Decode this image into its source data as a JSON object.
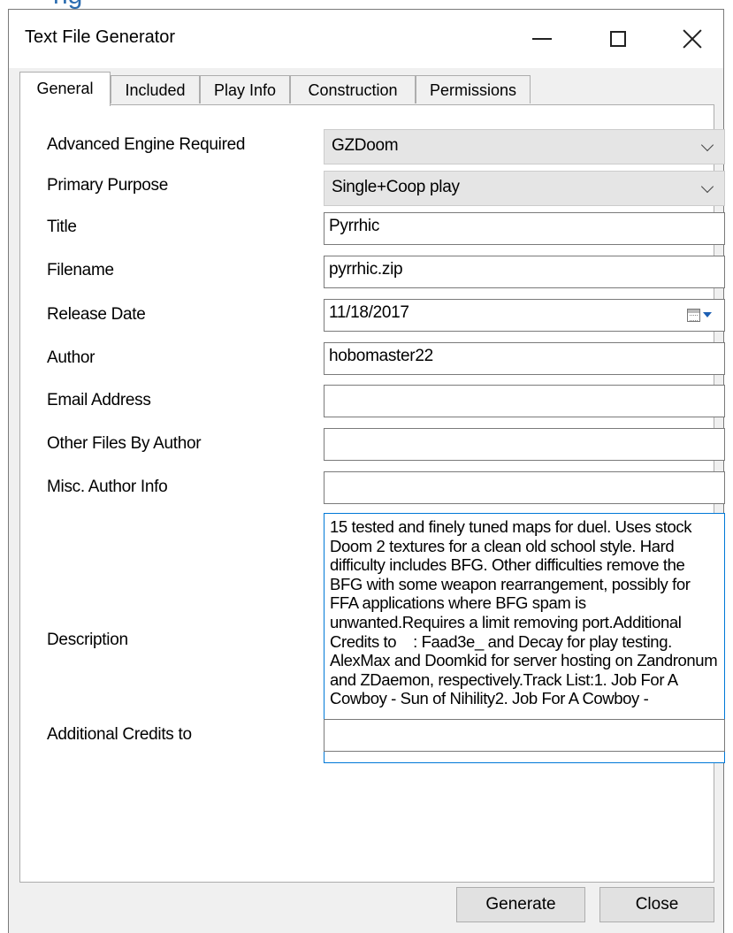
{
  "window": {
    "title": "Text File Generator"
  },
  "tabs": [
    {
      "label": "General"
    },
    {
      "label": "Included"
    },
    {
      "label": "Play Info"
    },
    {
      "label": "Construction"
    },
    {
      "label": "Permissions"
    }
  ],
  "form": {
    "engine_label": "Advanced Engine Required",
    "engine_value": "GZDoom",
    "purpose_label": "Primary Purpose",
    "purpose_value": "Single+Coop play",
    "title_label": "Title",
    "title_value": "Pyrrhic",
    "filename_label": "Filename",
    "filename_value": "pyrrhic.zip",
    "release_label": "Release Date",
    "release_value": "11/18/2017",
    "author_label": "Author",
    "author_value": "hobomaster22",
    "email_label": "Email Address",
    "email_value": "",
    "other_label": "Other Files By Author",
    "other_value": "",
    "misc_label": "Misc. Author Info",
    "misc_value": "",
    "desc_label": "Description",
    "desc_value": "15 tested and finely tuned maps for duel. Uses stock Doom 2 textures for a clean old school style. Hard difficulty includes BFG. Other difficulties remove the BFG with some weapon rearrangement, possibly for FFA applications where BFG spam is unwanted.Requires a limit removing port.Additional Credits to    : Faad3e_ and Decay for play testing. AlexMax and Doomkid for server hosting on Zandronum and ZDaemon, respectively.Track List:1. Job For A Cowboy - Sun of Nihility2. Job For A Cowboy -",
    "credits_label": "Additional Credits to",
    "credits_value": ""
  },
  "buttons": {
    "generate": "Generate",
    "close": "Close"
  }
}
